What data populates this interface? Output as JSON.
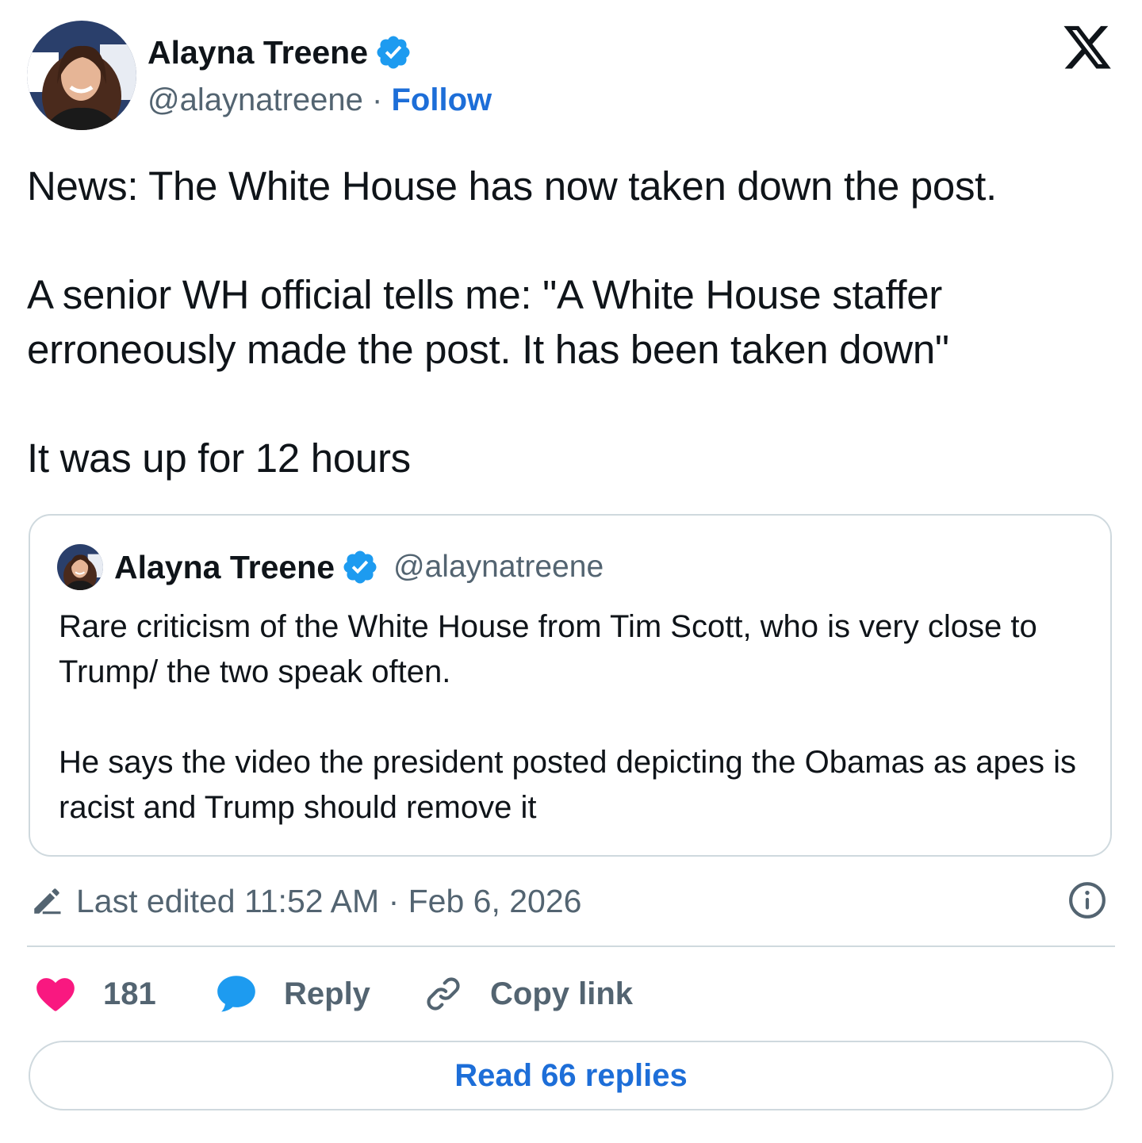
{
  "author": {
    "name": "Alayna Treene",
    "handle": "@alaynatreene",
    "separator": "·",
    "follow_label": "Follow",
    "verified": true
  },
  "brand": {
    "logo_icon": "x-logo-icon"
  },
  "tweet": {
    "paragraphs": [
      "News: The White House has now taken down the post.",
      "A senior WH official tells me: \"A White House staffer erroneously made the post. It has been taken down\"",
      "It was up for 12 hours"
    ]
  },
  "quoted_tweet": {
    "author_name": "Alayna Treene",
    "handle": "@alaynatreene",
    "verified": true,
    "paragraphs": [
      "Rare criticism of the White House from Tim Scott, who is very close to Trump/ the two speak often.",
      "He says the video the president posted depicting the Obamas as apes is racist and Trump should remove it"
    ]
  },
  "edited": {
    "label": "Last edited 11:52 AM · Feb 6, 2026",
    "icon": "pencil-icon"
  },
  "actions": {
    "like_count": "181",
    "reply_label": "Reply",
    "copy_link_label": "Copy link"
  },
  "footer": {
    "read_replies_label": "Read 66 replies"
  },
  "colors": {
    "link_blue": "#1d6ed8",
    "verified_blue": "#1d9bf0",
    "like_pink": "#f91880",
    "muted_text": "#536471",
    "border": "#cfd9de"
  }
}
